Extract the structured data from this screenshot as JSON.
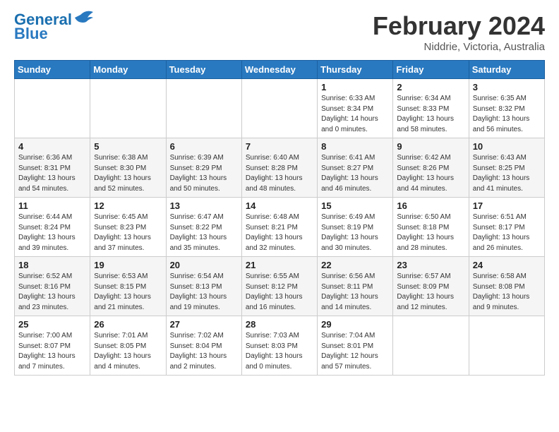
{
  "logo": {
    "line1": "General",
    "line2": "Blue"
  },
  "title": "February 2024",
  "location": "Niddrie, Victoria, Australia",
  "days_header": [
    "Sunday",
    "Monday",
    "Tuesday",
    "Wednesday",
    "Thursday",
    "Friday",
    "Saturday"
  ],
  "weeks": [
    [
      {
        "num": "",
        "info": ""
      },
      {
        "num": "",
        "info": ""
      },
      {
        "num": "",
        "info": ""
      },
      {
        "num": "",
        "info": ""
      },
      {
        "num": "1",
        "info": "Sunrise: 6:33 AM\nSunset: 8:34 PM\nDaylight: 14 hours\nand 0 minutes."
      },
      {
        "num": "2",
        "info": "Sunrise: 6:34 AM\nSunset: 8:33 PM\nDaylight: 13 hours\nand 58 minutes."
      },
      {
        "num": "3",
        "info": "Sunrise: 6:35 AM\nSunset: 8:32 PM\nDaylight: 13 hours\nand 56 minutes."
      }
    ],
    [
      {
        "num": "4",
        "info": "Sunrise: 6:36 AM\nSunset: 8:31 PM\nDaylight: 13 hours\nand 54 minutes."
      },
      {
        "num": "5",
        "info": "Sunrise: 6:38 AM\nSunset: 8:30 PM\nDaylight: 13 hours\nand 52 minutes."
      },
      {
        "num": "6",
        "info": "Sunrise: 6:39 AM\nSunset: 8:29 PM\nDaylight: 13 hours\nand 50 minutes."
      },
      {
        "num": "7",
        "info": "Sunrise: 6:40 AM\nSunset: 8:28 PM\nDaylight: 13 hours\nand 48 minutes."
      },
      {
        "num": "8",
        "info": "Sunrise: 6:41 AM\nSunset: 8:27 PM\nDaylight: 13 hours\nand 46 minutes."
      },
      {
        "num": "9",
        "info": "Sunrise: 6:42 AM\nSunset: 8:26 PM\nDaylight: 13 hours\nand 44 minutes."
      },
      {
        "num": "10",
        "info": "Sunrise: 6:43 AM\nSunset: 8:25 PM\nDaylight: 13 hours\nand 41 minutes."
      }
    ],
    [
      {
        "num": "11",
        "info": "Sunrise: 6:44 AM\nSunset: 8:24 PM\nDaylight: 13 hours\nand 39 minutes."
      },
      {
        "num": "12",
        "info": "Sunrise: 6:45 AM\nSunset: 8:23 PM\nDaylight: 13 hours\nand 37 minutes."
      },
      {
        "num": "13",
        "info": "Sunrise: 6:47 AM\nSunset: 8:22 PM\nDaylight: 13 hours\nand 35 minutes."
      },
      {
        "num": "14",
        "info": "Sunrise: 6:48 AM\nSunset: 8:21 PM\nDaylight: 13 hours\nand 32 minutes."
      },
      {
        "num": "15",
        "info": "Sunrise: 6:49 AM\nSunset: 8:19 PM\nDaylight: 13 hours\nand 30 minutes."
      },
      {
        "num": "16",
        "info": "Sunrise: 6:50 AM\nSunset: 8:18 PM\nDaylight: 13 hours\nand 28 minutes."
      },
      {
        "num": "17",
        "info": "Sunrise: 6:51 AM\nSunset: 8:17 PM\nDaylight: 13 hours\nand 26 minutes."
      }
    ],
    [
      {
        "num": "18",
        "info": "Sunrise: 6:52 AM\nSunset: 8:16 PM\nDaylight: 13 hours\nand 23 minutes."
      },
      {
        "num": "19",
        "info": "Sunrise: 6:53 AM\nSunset: 8:15 PM\nDaylight: 13 hours\nand 21 minutes."
      },
      {
        "num": "20",
        "info": "Sunrise: 6:54 AM\nSunset: 8:13 PM\nDaylight: 13 hours\nand 19 minutes."
      },
      {
        "num": "21",
        "info": "Sunrise: 6:55 AM\nSunset: 8:12 PM\nDaylight: 13 hours\nand 16 minutes."
      },
      {
        "num": "22",
        "info": "Sunrise: 6:56 AM\nSunset: 8:11 PM\nDaylight: 13 hours\nand 14 minutes."
      },
      {
        "num": "23",
        "info": "Sunrise: 6:57 AM\nSunset: 8:09 PM\nDaylight: 13 hours\nand 12 minutes."
      },
      {
        "num": "24",
        "info": "Sunrise: 6:58 AM\nSunset: 8:08 PM\nDaylight: 13 hours\nand 9 minutes."
      }
    ],
    [
      {
        "num": "25",
        "info": "Sunrise: 7:00 AM\nSunset: 8:07 PM\nDaylight: 13 hours\nand 7 minutes."
      },
      {
        "num": "26",
        "info": "Sunrise: 7:01 AM\nSunset: 8:05 PM\nDaylight: 13 hours\nand 4 minutes."
      },
      {
        "num": "27",
        "info": "Sunrise: 7:02 AM\nSunset: 8:04 PM\nDaylight: 13 hours\nand 2 minutes."
      },
      {
        "num": "28",
        "info": "Sunrise: 7:03 AM\nSunset: 8:03 PM\nDaylight: 13 hours\nand 0 minutes."
      },
      {
        "num": "29",
        "info": "Sunrise: 7:04 AM\nSunset: 8:01 PM\nDaylight: 12 hours\nand 57 minutes."
      },
      {
        "num": "",
        "info": ""
      },
      {
        "num": "",
        "info": ""
      }
    ]
  ]
}
